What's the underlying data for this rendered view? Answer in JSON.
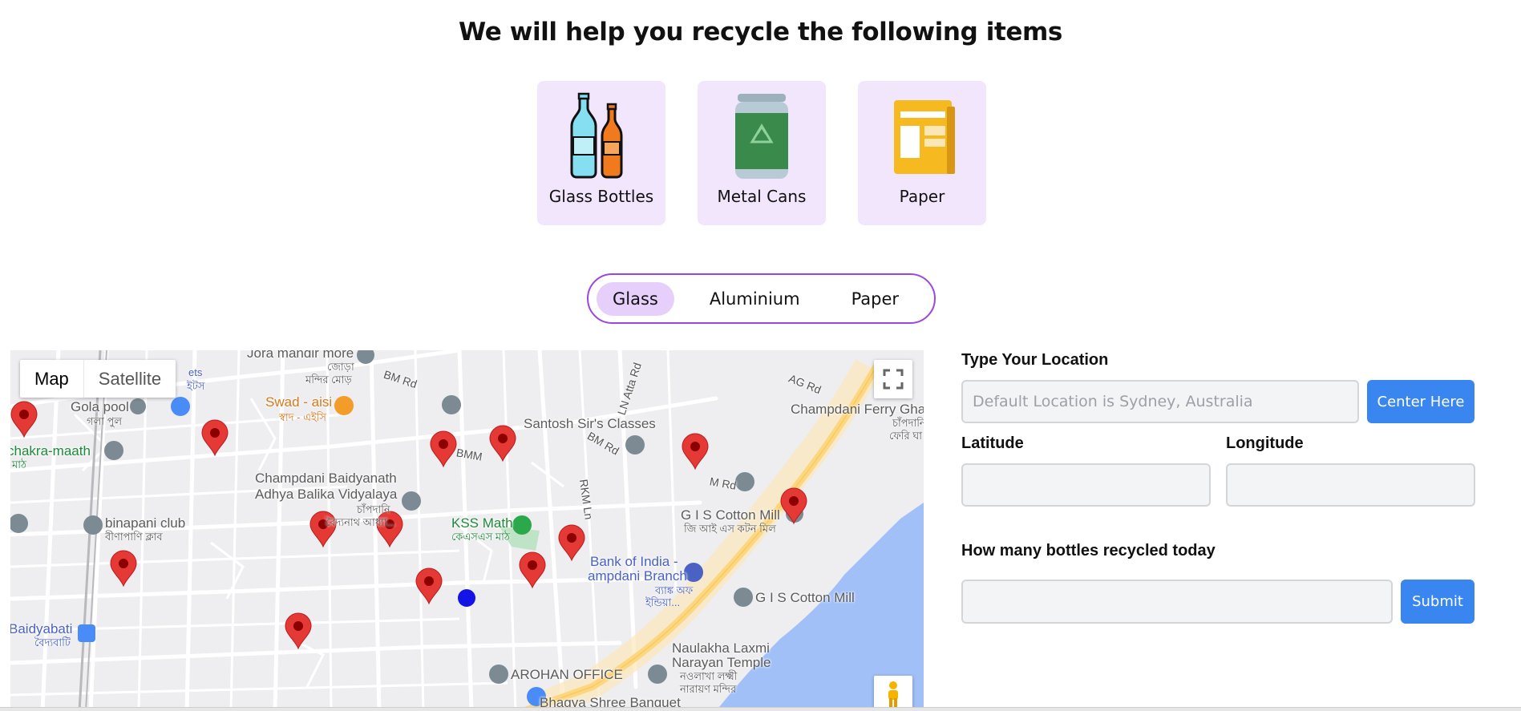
{
  "header": {
    "title": "We will help you recycle the following items"
  },
  "categories": [
    {
      "label": "Glass Bottles",
      "icon": "glass-bottles-icon"
    },
    {
      "label": "Metal Cans",
      "icon": "metal-can-icon"
    },
    {
      "label": "Paper",
      "icon": "paper-icon"
    }
  ],
  "tabs": {
    "items": [
      {
        "label": "Glass",
        "active": true
      },
      {
        "label": "Aluminium",
        "active": false
      },
      {
        "label": "Paper",
        "active": false
      }
    ],
    "accent": "#9b45e4",
    "active_bg": "#e6cffb"
  },
  "map": {
    "type_map": "Map",
    "type_satellite": "Satellite",
    "labels": {
      "jora_mandir": "Jora mandir more",
      "jora_bn": "জোড়া",
      "mandir_bn": "মন্দির মোড়",
      "bm_rd_1": "BM Rd",
      "bm_rd_2": "BM Rd",
      "bmm": "BMM",
      "ag_rd": "AG Rd",
      "ln_atta": "LN Atta Rd",
      "rkm_ln": "RKM Ln",
      "m_rd": "M Rd",
      "gola_pool": "Gola pool",
      "gola_bn": "গলা পুল",
      "ets": "ets",
      "ets_bn": "ইটস",
      "swad": "Swad - aisi",
      "swad_bn": "স্বাদ - এইসি",
      "santosh": "Santosh Sir's Classes",
      "champdani_ferry": "Champdani Ferry Gha",
      "champdani_ferry_bn1": "চাঁপদানি",
      "champdani_ferry_bn2": "ফেরি ঘা",
      "chakra": "chakra-maath",
      "chakra_bn": "মাঠ",
      "baidyanath_1": "Champdani Baidyanath",
      "baidyanath_2": "Adhya Balika Vidyalaya",
      "baidyanath_bn1": "চাঁপদানি",
      "baidyanath_bn2": "বৈদ্যনাথ আধ্যা...",
      "binapani": "binapani club",
      "binapani_bn": "বীণাপাণি ক্লাব",
      "kss": "KSS Math",
      "kss_bn": "কেএসএস মাঠ",
      "gis_cotton": "G I S Cotton Mill",
      "gis_cotton_bn": "জি আই এস কটন মিল",
      "bank_1": "Bank of India -",
      "bank_2": "ampdani Branch",
      "bank_bn1": "ব্যাঙ্ক অফ",
      "bank_bn2": "ইন্ডিয়া...",
      "gis_cotton_2": "G I S Cotton Mill",
      "baidyabati": "Baidyabati",
      "baidyabati_bn": "বৈদ্যবাটি",
      "naulakha_1": "Naulakha Laxmi",
      "naulakha_2": "Narayan Temple",
      "naulakha_bn1": "নওলাখা লক্ষ্মী",
      "naulakha_bn2": "নারায়ণ মন্দির",
      "arohan": "AROHAN OFFICE",
      "bhagya": "Bhagya Shree Banquet"
    },
    "marker_color": "#e53935",
    "current_location_color": "#1414e6",
    "water_color": "#a1c0f7",
    "highway_color": "#fdd77f"
  },
  "form": {
    "location_label": "Type Your Location",
    "location_placeholder": "Default Location is Sydney, Australia",
    "location_value": "",
    "center_button": "Center Here",
    "latitude_label": "Latitude",
    "latitude_value": "",
    "longitude_label": "Longitude",
    "longitude_value": "",
    "count_label": "How many bottles recycled today",
    "count_value": "",
    "submit_button": "Submit",
    "button_color": "#3a86f0"
  }
}
